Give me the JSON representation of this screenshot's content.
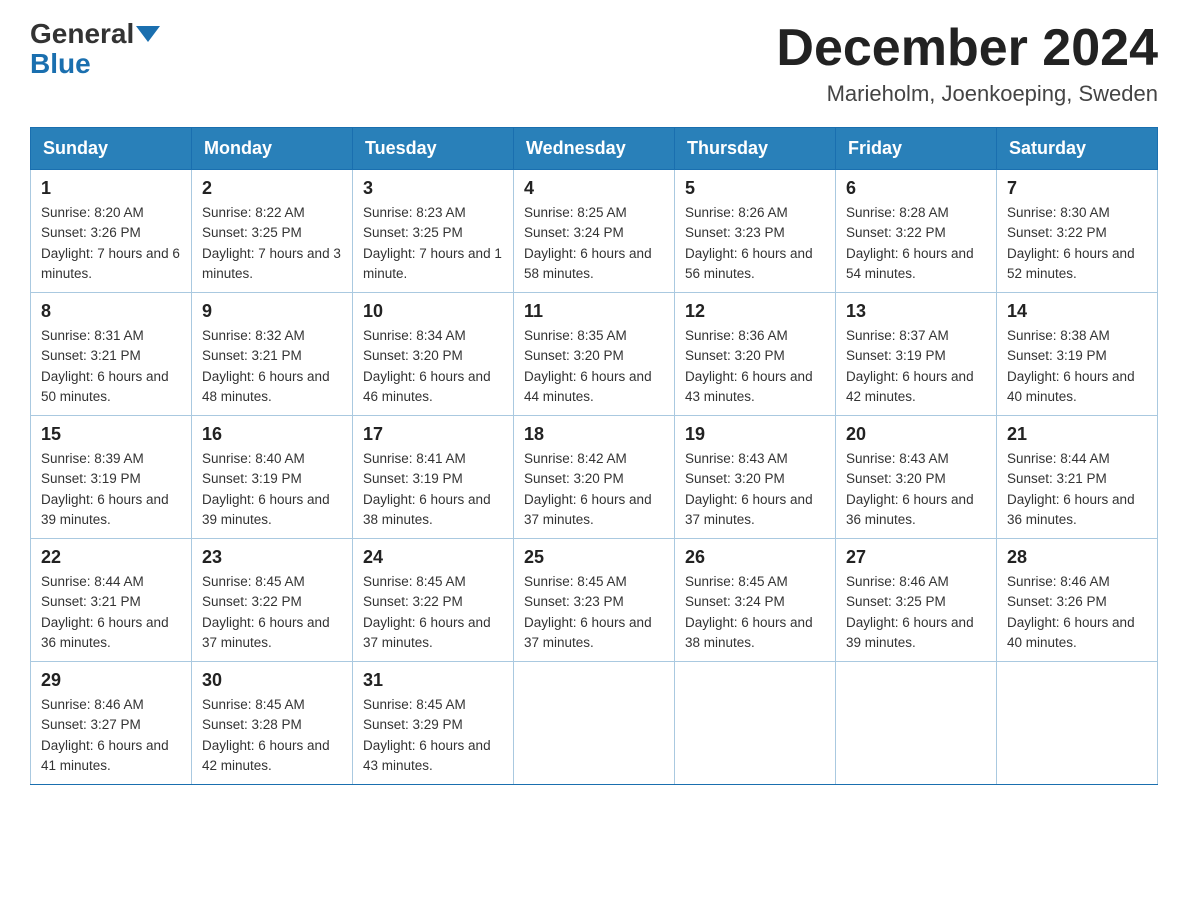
{
  "header": {
    "logo_general": "General",
    "logo_blue": "Blue",
    "month_title": "December 2024",
    "location": "Marieholm, Joenkoeping, Sweden"
  },
  "days_of_week": [
    "Sunday",
    "Monday",
    "Tuesday",
    "Wednesday",
    "Thursday",
    "Friday",
    "Saturday"
  ],
  "weeks": [
    [
      {
        "day": "1",
        "sunrise": "8:20 AM",
        "sunset": "3:26 PM",
        "daylight": "7 hours and 6 minutes."
      },
      {
        "day": "2",
        "sunrise": "8:22 AM",
        "sunset": "3:25 PM",
        "daylight": "7 hours and 3 minutes."
      },
      {
        "day": "3",
        "sunrise": "8:23 AM",
        "sunset": "3:25 PM",
        "daylight": "7 hours and 1 minute."
      },
      {
        "day": "4",
        "sunrise": "8:25 AM",
        "sunset": "3:24 PM",
        "daylight": "6 hours and 58 minutes."
      },
      {
        "day": "5",
        "sunrise": "8:26 AM",
        "sunset": "3:23 PM",
        "daylight": "6 hours and 56 minutes."
      },
      {
        "day": "6",
        "sunrise": "8:28 AM",
        "sunset": "3:22 PM",
        "daylight": "6 hours and 54 minutes."
      },
      {
        "day": "7",
        "sunrise": "8:30 AM",
        "sunset": "3:22 PM",
        "daylight": "6 hours and 52 minutes."
      }
    ],
    [
      {
        "day": "8",
        "sunrise": "8:31 AM",
        "sunset": "3:21 PM",
        "daylight": "6 hours and 50 minutes."
      },
      {
        "day": "9",
        "sunrise": "8:32 AM",
        "sunset": "3:21 PM",
        "daylight": "6 hours and 48 minutes."
      },
      {
        "day": "10",
        "sunrise": "8:34 AM",
        "sunset": "3:20 PM",
        "daylight": "6 hours and 46 minutes."
      },
      {
        "day": "11",
        "sunrise": "8:35 AM",
        "sunset": "3:20 PM",
        "daylight": "6 hours and 44 minutes."
      },
      {
        "day": "12",
        "sunrise": "8:36 AM",
        "sunset": "3:20 PM",
        "daylight": "6 hours and 43 minutes."
      },
      {
        "day": "13",
        "sunrise": "8:37 AM",
        "sunset": "3:19 PM",
        "daylight": "6 hours and 42 minutes."
      },
      {
        "day": "14",
        "sunrise": "8:38 AM",
        "sunset": "3:19 PM",
        "daylight": "6 hours and 40 minutes."
      }
    ],
    [
      {
        "day": "15",
        "sunrise": "8:39 AM",
        "sunset": "3:19 PM",
        "daylight": "6 hours and 39 minutes."
      },
      {
        "day": "16",
        "sunrise": "8:40 AM",
        "sunset": "3:19 PM",
        "daylight": "6 hours and 39 minutes."
      },
      {
        "day": "17",
        "sunrise": "8:41 AM",
        "sunset": "3:19 PM",
        "daylight": "6 hours and 38 minutes."
      },
      {
        "day": "18",
        "sunrise": "8:42 AM",
        "sunset": "3:20 PM",
        "daylight": "6 hours and 37 minutes."
      },
      {
        "day": "19",
        "sunrise": "8:43 AM",
        "sunset": "3:20 PM",
        "daylight": "6 hours and 37 minutes."
      },
      {
        "day": "20",
        "sunrise": "8:43 AM",
        "sunset": "3:20 PM",
        "daylight": "6 hours and 36 minutes."
      },
      {
        "day": "21",
        "sunrise": "8:44 AM",
        "sunset": "3:21 PM",
        "daylight": "6 hours and 36 minutes."
      }
    ],
    [
      {
        "day": "22",
        "sunrise": "8:44 AM",
        "sunset": "3:21 PM",
        "daylight": "6 hours and 36 minutes."
      },
      {
        "day": "23",
        "sunrise": "8:45 AM",
        "sunset": "3:22 PM",
        "daylight": "6 hours and 37 minutes."
      },
      {
        "day": "24",
        "sunrise": "8:45 AM",
        "sunset": "3:22 PM",
        "daylight": "6 hours and 37 minutes."
      },
      {
        "day": "25",
        "sunrise": "8:45 AM",
        "sunset": "3:23 PM",
        "daylight": "6 hours and 37 minutes."
      },
      {
        "day": "26",
        "sunrise": "8:45 AM",
        "sunset": "3:24 PM",
        "daylight": "6 hours and 38 minutes."
      },
      {
        "day": "27",
        "sunrise": "8:46 AM",
        "sunset": "3:25 PM",
        "daylight": "6 hours and 39 minutes."
      },
      {
        "day": "28",
        "sunrise": "8:46 AM",
        "sunset": "3:26 PM",
        "daylight": "6 hours and 40 minutes."
      }
    ],
    [
      {
        "day": "29",
        "sunrise": "8:46 AM",
        "sunset": "3:27 PM",
        "daylight": "6 hours and 41 minutes."
      },
      {
        "day": "30",
        "sunrise": "8:45 AM",
        "sunset": "3:28 PM",
        "daylight": "6 hours and 42 minutes."
      },
      {
        "day": "31",
        "sunrise": "8:45 AM",
        "sunset": "3:29 PM",
        "daylight": "6 hours and 43 minutes."
      },
      null,
      null,
      null,
      null
    ]
  ]
}
